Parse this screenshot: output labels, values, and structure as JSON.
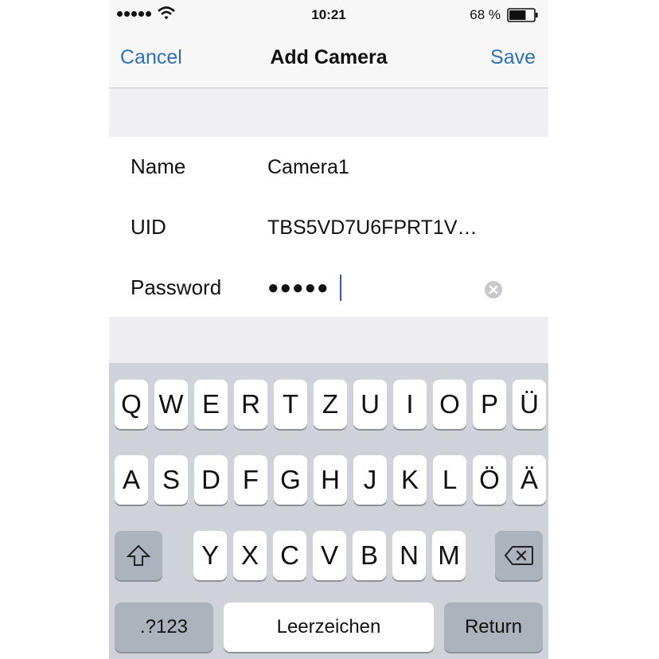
{
  "status_bar": {
    "signal_icon": "signal-dots-icon",
    "wifi_icon": "wifi-icon",
    "time": "10:21",
    "battery_percent": "68 %",
    "battery_level": 0.68,
    "battery_icon": "battery-icon"
  },
  "nav": {
    "cancel_label": "Cancel",
    "title": "Add Camera",
    "save_label": "Save",
    "accent_color": "#2f6fb7"
  },
  "form": {
    "name_label": "Name",
    "name_value": "Camera1",
    "uid_label": "UID",
    "uid_value": "TBS5VD7U6FPRT1V…",
    "password_label": "Password",
    "password_value": "●●●●●",
    "clear_icon": "clear-circle-icon"
  },
  "keyboard": {
    "row1": [
      "Q",
      "W",
      "E",
      "R",
      "T",
      "Z",
      "U",
      "I",
      "O",
      "P",
      "Ü"
    ],
    "row2": [
      "A",
      "S",
      "D",
      "F",
      "G",
      "H",
      "J",
      "K",
      "L",
      "Ö",
      "Ä"
    ],
    "row3": [
      "Y",
      "X",
      "C",
      "V",
      "B",
      "N",
      "M"
    ],
    "shift_icon": "shift-arrow-icon",
    "backspace_icon": "backspace-icon",
    "numbers_label": ".?123",
    "space_label": "Leerzeichen",
    "return_label": "Return"
  }
}
